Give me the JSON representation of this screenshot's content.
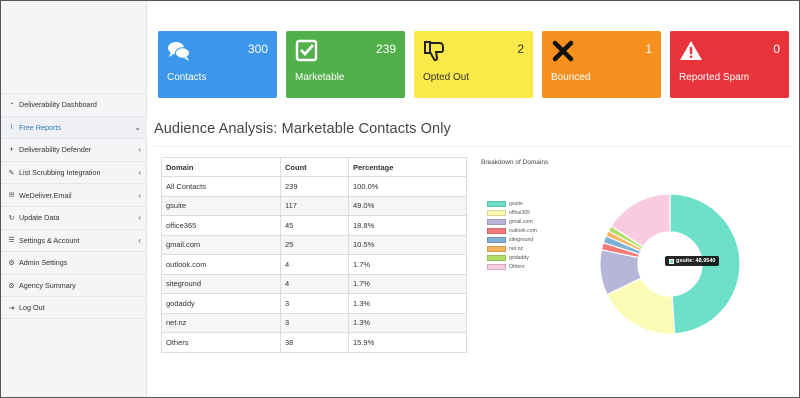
{
  "sidebar": {
    "items": [
      {
        "label": "Deliverability Dashboard",
        "icon": "dashboard-icon",
        "caret": "",
        "active": false
      },
      {
        "label": "Free Reports",
        "icon": "line-chart-icon",
        "caret": "⌄",
        "active": true
      },
      {
        "label": "Deliverability Defender",
        "icon": "shield-icon",
        "caret": "‹",
        "active": false
      },
      {
        "label": "List Scrubbing Integration",
        "icon": "brush-icon",
        "caret": "‹",
        "active": false
      },
      {
        "label": "WeDeliver.Email",
        "icon": "envelope-icon",
        "caret": "‹",
        "active": false
      },
      {
        "label": "Update Data",
        "icon": "refresh-icon",
        "caret": "‹",
        "active": false
      },
      {
        "label": "Settings & Account",
        "icon": "list-icon",
        "caret": "‹",
        "active": false
      },
      {
        "label": "Admin Settings",
        "icon": "gears-icon",
        "caret": "",
        "active": false
      },
      {
        "label": "Agency Summary",
        "icon": "gears-icon",
        "caret": "",
        "active": false
      },
      {
        "label": "Log Out",
        "icon": "logout-icon",
        "caret": "",
        "active": false
      }
    ]
  },
  "cards": [
    {
      "label": "Contacts",
      "count": "300",
      "color": "#3c97ea",
      "icon": "comments-icon"
    },
    {
      "label": "Marketable",
      "count": "239",
      "color": "#52b04a",
      "icon": "check-square-icon"
    },
    {
      "label": "Opted Out",
      "count": "2",
      "color": "#fbe94a",
      "icon": "thumbs-down-icon"
    },
    {
      "label": "Bounced",
      "count": "1",
      "color": "#f7901f",
      "icon": "x-icon"
    },
    {
      "label": "Reported Spam",
      "count": "0",
      "color": "#e8333a",
      "icon": "warning-icon"
    }
  ],
  "page_title": "Audience Analysis: Marketable Contacts Only",
  "table": {
    "headers": [
      "Domain",
      "Count",
      "Percentage"
    ],
    "rows": [
      [
        "All Contacts",
        "239",
        "100.0%"
      ],
      [
        "gsuite",
        "117",
        "49.0%"
      ],
      [
        "office365",
        "45",
        "18.8%"
      ],
      [
        "gmail.com",
        "25",
        "10.5%"
      ],
      [
        "outlook.com",
        "4",
        "1.7%"
      ],
      [
        "siteground",
        "4",
        "1.7%"
      ],
      [
        "godaddy",
        "3",
        "1.3%"
      ],
      [
        "net.nz",
        "3",
        "1.3%"
      ],
      [
        "Others",
        "38",
        "15.9%"
      ]
    ]
  },
  "chart_data": {
    "type": "pie",
    "title": "Breakdown of Domains",
    "categories": [
      "gsuite",
      "office365",
      "gmail.com",
      "outlook.com",
      "siteground",
      "net.nz",
      "godaddy",
      "Others"
    ],
    "values": [
      117,
      45,
      25,
      4,
      4,
      3,
      3,
      38
    ],
    "colors": [
      "#6ee0c9",
      "#fbfbb6",
      "#b8b6d8",
      "#f47a78",
      "#80b1d4",
      "#f9b460",
      "#b0dd6a",
      "#f9cbe0"
    ],
    "legend_placement": "left",
    "tooltip": {
      "label": "gsuite: 48.9540",
      "color": "#6ee0c9"
    }
  }
}
